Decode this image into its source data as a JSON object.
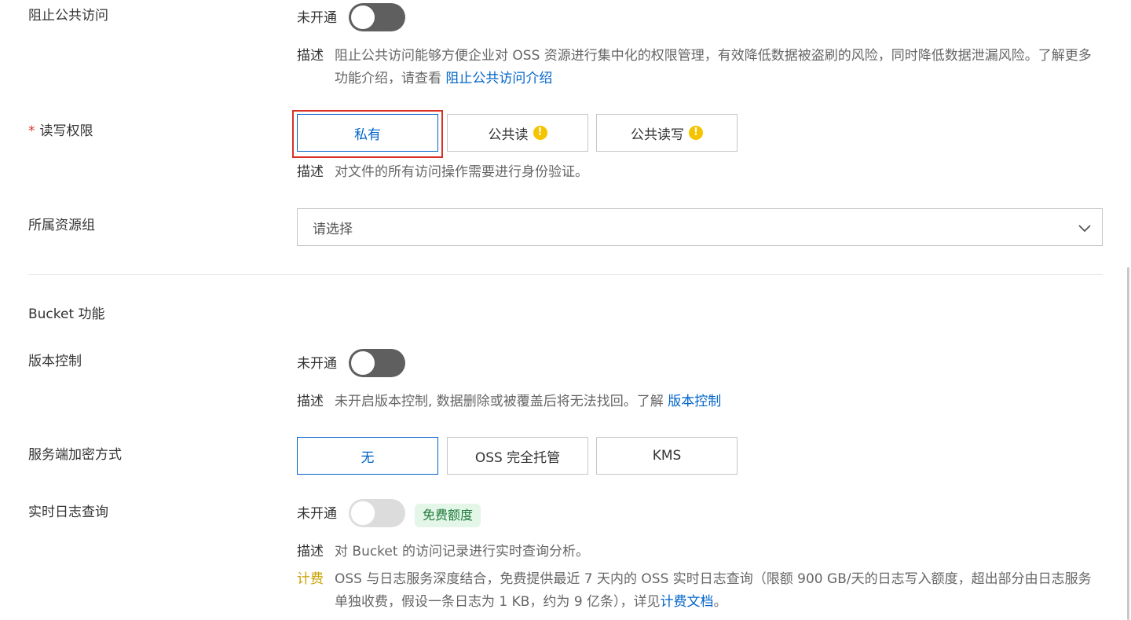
{
  "block_public_access": {
    "label": "阻止公共访问",
    "state": "未开通",
    "desc_key": "描述",
    "desc_text": "阻止公共访问能够方便企业对 OSS 资源进行集中化的权限管理，有效降低数据被盗刷的风险，同时降低数据泄漏风险。了解更多功能介绍，请查看",
    "desc_link": "阻止公共访问介绍"
  },
  "acl": {
    "required_mark": "*",
    "label": "读写权限",
    "options": [
      "私有",
      "公共读",
      "公共读写"
    ],
    "selected": "私有",
    "desc_key": "描述",
    "desc_text": "对文件的所有访问操作需要进行身份验证。"
  },
  "resource_group": {
    "label": "所属资源组",
    "placeholder": "请选择"
  },
  "bucket_features": {
    "section_title": "Bucket 功能"
  },
  "versioning": {
    "label": "版本控制",
    "state": "未开通",
    "desc_key": "描述",
    "desc_text": "未开启版本控制, 数据删除或被覆盖后将无法找回。了解",
    "desc_link": "版本控制"
  },
  "encryption": {
    "label": "服务端加密方式",
    "options": [
      "无",
      "OSS 完全托管",
      "KMS"
    ],
    "selected": "无"
  },
  "realtime_log": {
    "label": "实时日志查询",
    "state": "未开通",
    "badge": "免费额度",
    "desc_key": "描述",
    "desc_text": "对 Bucket 的访问记录进行实时查询分析。",
    "fee_key": "计费",
    "fee_text": "OSS 与日志服务深度结合，免费提供最近 7 天内的 OSS 实时日志查询（限额 900 GB/天的日志写入额度，超出部分由日志服务单独收费，假设一条日志为 1 KB，约为 9 亿条），详见",
    "fee_link": "计费文档",
    "fee_tail": "。"
  },
  "colors": {
    "accent": "#0064c8",
    "highlight": "#d93026",
    "warning": "#f5c400",
    "fee": "#c9a100"
  }
}
